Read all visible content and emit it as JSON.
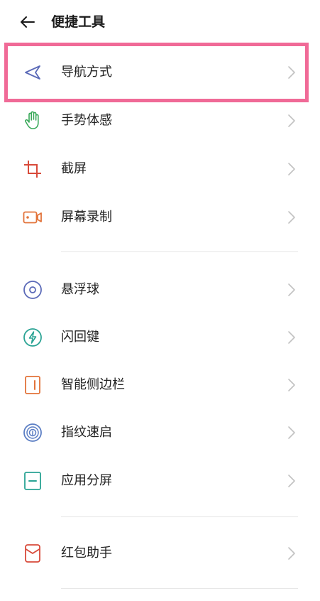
{
  "header": {
    "title": "便捷工具",
    "back_icon": "back-arrow-icon"
  },
  "colors": {
    "highlight": "#f06a97",
    "text": "#222222",
    "chevron": "#c2c2c2",
    "divider": "#e6e6e6"
  },
  "items": [
    {
      "label": "导航方式",
      "icon": "navigation-arrow-icon",
      "color": "#5b6ab8"
    },
    {
      "label": "手势体感",
      "icon": "hand-gesture-icon",
      "color": "#3aa95a"
    },
    {
      "label": "截屏",
      "icon": "crop-icon",
      "color": "#d84a3a"
    },
    {
      "label": "屏幕录制",
      "icon": "video-record-icon",
      "color": "#e2733a"
    },
    {
      "label": "悬浮球",
      "icon": "floating-ball-icon",
      "color": "#5b6ab8"
    },
    {
      "label": "闪回键",
      "icon": "flash-icon",
      "color": "#2aa394"
    },
    {
      "label": "智能侧边栏",
      "icon": "sidebar-icon",
      "color": "#e2733a"
    },
    {
      "label": "指纹速启",
      "icon": "fingerprint-icon",
      "color": "#5b7ec4"
    },
    {
      "label": "应用分屏",
      "icon": "split-screen-icon",
      "color": "#2aa394"
    },
    {
      "label": "红包助手",
      "icon": "red-envelope-icon",
      "color": "#d84a3a"
    }
  ]
}
